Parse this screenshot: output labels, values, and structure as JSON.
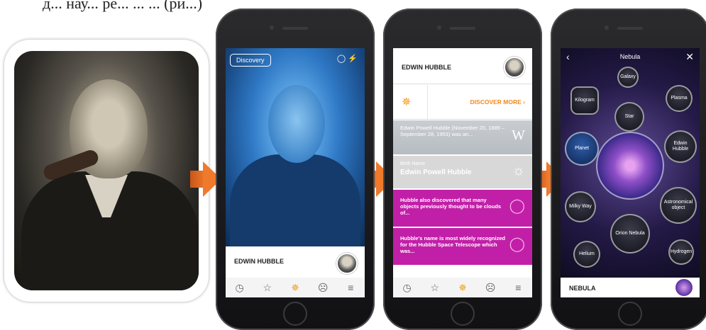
{
  "caption_partial": "д... нау... ре... ... ... (ри...)",
  "phone1": {
    "discovery_label": "Discovery",
    "name": "EDWIN HUBBLE",
    "tabs": [
      "◷",
      "☆",
      "✵",
      "☹",
      "≡"
    ]
  },
  "phone2": {
    "name": "EDWIN HUBBLE",
    "discover_more": "DISCOVER MORE ›",
    "card1_text": "Edwin Powell Hubble (November 20, 1889 – September 28, 1953) was an...",
    "card2_small": "Birth Name",
    "card2_big": "Edwin Powell Hubble",
    "card3_text": "Hubble also discovered that many objects previously thought to be clouds of...",
    "card4_text": "Hubble's name is most widely recognized for the Hubble Space Telescope which was...",
    "tabs": [
      "◷",
      "☆",
      "✵",
      "☹",
      "≡"
    ]
  },
  "phone3": {
    "title": "Nebula",
    "bubbles": {
      "galaxy": "Galaxy",
      "kilogram": "Kilogram",
      "plasma": "Plasma",
      "star": "Star",
      "planet": "Planet",
      "edwin_hubble": "Edwin Hubble",
      "milky_way": "Milky Way",
      "astronomical_object": "Astronomical object",
      "orion_nebula": "Orion Nebula",
      "helium": "Helium",
      "hydrogen": "Hydrogen"
    },
    "bottom_name": "NEBULA"
  },
  "colors": {
    "accent_orange": "#f08a1e",
    "magenta_card": "#c21fa8",
    "arrow_orange": "#f07a2b"
  }
}
